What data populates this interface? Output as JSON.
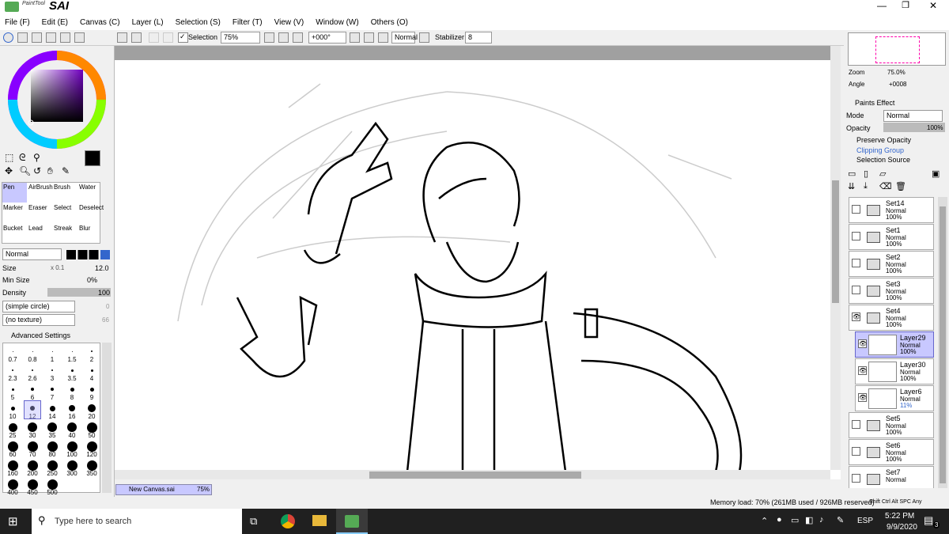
{
  "app": {
    "title": "SAI",
    "subtitle": "PaintTool"
  },
  "menu": [
    "File (F)",
    "Edit (E)",
    "Canvas (C)",
    "Layer (L)",
    "Selection (S)",
    "Filter (T)",
    "View (V)",
    "Window (W)",
    "Others (O)"
  ],
  "toolbar": {
    "selection_label": "Selection",
    "zoom": "75%",
    "angle": "+000°",
    "blend": "Normal",
    "stabilizer_label": "Stabilizer",
    "stabilizer": "8"
  },
  "tools": [
    "Pen",
    "AirBrush",
    "Brush",
    "Water",
    "Marker",
    "Eraser",
    "Select",
    "Deselect",
    "Bucket",
    "Lead",
    "Streak",
    "Blur"
  ],
  "brush": {
    "mode": "Normal",
    "size_label": "Size",
    "size_mult": "x 0.1",
    "size": "12.0",
    "minsize_label": "Min Size",
    "minsize": "0%",
    "density_label": "Density",
    "density": "100",
    "shape": "(simple circle)",
    "shape_val": "0",
    "texture": "(no texture)",
    "texture_val": "66",
    "advanced": "Advanced Settings"
  },
  "sizes": [
    "0.7",
    "0.8",
    "1",
    "1.5",
    "2",
    "2.3",
    "2.6",
    "3",
    "3.5",
    "4",
    "5",
    "6",
    "7",
    "8",
    "9",
    "10",
    "12",
    "14",
    "16",
    "20",
    "25",
    "30",
    "35",
    "40",
    "50",
    "60",
    "70",
    "80",
    "100",
    "120",
    "160",
    "200",
    "250",
    "300",
    "350",
    "400",
    "450",
    "500"
  ],
  "canvas_tab": {
    "name": "New Canvas.sai",
    "zoom": "75%"
  },
  "nav": {
    "zoom_label": "Zoom",
    "zoom": "75.0%",
    "angle_label": "Angle",
    "angle": "+0008"
  },
  "layerprops": {
    "paints_effect": "Paints Effect",
    "mode_label": "Mode",
    "mode": "Normal",
    "opacity_label": "Opacity",
    "opacity": "100%",
    "preserve": "Preserve Opacity",
    "clipping": "Clipping Group",
    "selsource": "Selection Source"
  },
  "layers": [
    {
      "name": "Set14",
      "mode": "Normal",
      "opacity": "100%",
      "type": "folder"
    },
    {
      "name": "Set1",
      "mode": "Normal",
      "opacity": "100%",
      "type": "folder"
    },
    {
      "name": "Set2",
      "mode": "Normal",
      "opacity": "100%",
      "type": "folder"
    },
    {
      "name": "Set3",
      "mode": "Normal",
      "opacity": "100%",
      "type": "folder"
    },
    {
      "name": "Set4",
      "mode": "Normal",
      "opacity": "100%",
      "type": "folder"
    },
    {
      "name": "Layer29",
      "mode": "Normal",
      "opacity": "100%",
      "type": "layer"
    },
    {
      "name": "Layer30",
      "mode": "Normal",
      "opacity": "100%",
      "type": "layer"
    },
    {
      "name": "Layer6",
      "mode": "Normal",
      "opacity": "11%",
      "type": "layer"
    },
    {
      "name": "Set5",
      "mode": "Normal",
      "opacity": "100%",
      "type": "folder"
    },
    {
      "name": "Set6",
      "mode": "Normal",
      "opacity": "100%",
      "type": "folder"
    },
    {
      "name": "Set7",
      "mode": "Normal",
      "opacity": "",
      "type": "folder"
    }
  ],
  "status": {
    "memory": "Memory load: 70% (261MB used / 926MB reserved)",
    "keys": "Shift Ctrl Alt SPC Any"
  },
  "taskbar": {
    "search": "Type here to search",
    "lang": "ESP",
    "time": "5:22 PM",
    "date": "9/9/2020",
    "notif": "3"
  },
  "colors": {
    "selected_layer": "#c8c8ff",
    "taskbar": "#202020",
    "accent": "#3c3cff"
  }
}
